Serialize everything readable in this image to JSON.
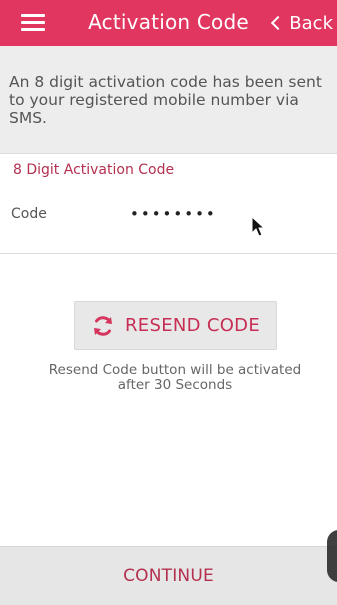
{
  "header": {
    "title": "Activation Code",
    "back_label": "Back",
    "menu_icon": "hamburger-menu-icon",
    "back_icon": "chevron-left-icon",
    "bg_color": "#e0365f"
  },
  "info": {
    "message": "An 8 digit activation code has been sent to your registered mobile number via SMS."
  },
  "form": {
    "heading": "8 Digit Activation Code",
    "code_label": "Code",
    "code_value": "••••••••"
  },
  "resend": {
    "button_label": "RESEND CODE",
    "icon": "refresh-icon",
    "note": "Resend Code button will be activated after 30 Seconds"
  },
  "footer": {
    "continue_label": "CONTINUE"
  },
  "colors": {
    "accent": "#e0365f",
    "accent_text": "#c62e54",
    "muted_text": "#555555",
    "panel_bg": "#ededed"
  }
}
